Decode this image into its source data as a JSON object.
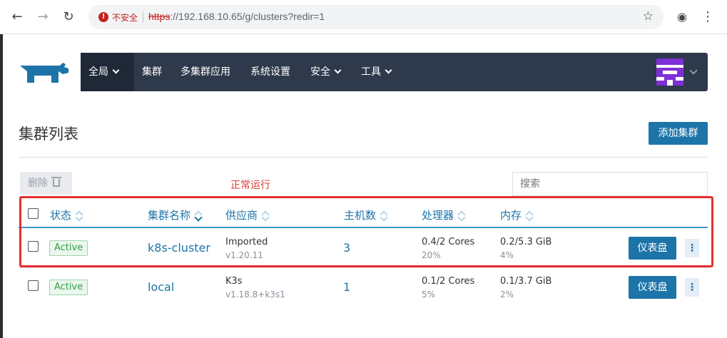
{
  "browser": {
    "insecure_label": "不安全",
    "url_protocol": "https",
    "url_rest": "://192.168.10.65/g/clusters?redir=1"
  },
  "nav": {
    "global": "全局",
    "items": [
      "集群",
      "多集群应用",
      "系统设置",
      "安全",
      "工具"
    ]
  },
  "page": {
    "title": "集群列表",
    "add_button": "添加集群",
    "delete_button": "删除",
    "annotation": "正常运行",
    "search_placeholder": "搜索"
  },
  "table": {
    "columns": [
      "状态",
      "集群名称",
      "供应商",
      "主机数",
      "处理器",
      "内存"
    ],
    "rows": [
      {
        "state": "Active",
        "name": "k8s-cluster",
        "provider": "Imported",
        "version": "v1.20.11",
        "nodes": "3",
        "cpu": "0.4/2 Cores",
        "cpu_pct": "20%",
        "mem": "0.2/5.3 GiB",
        "mem_pct": "4%",
        "dashboard": "仪表盘"
      },
      {
        "state": "Active",
        "name": "local",
        "provider": "K3s",
        "version": "v1.18.8+k3s1",
        "nodes": "1",
        "cpu": "0.1/2 Cores",
        "cpu_pct": "5%",
        "mem": "0.1/3.7 GiB",
        "mem_pct": "2%",
        "dashboard": "仪表盘"
      }
    ]
  },
  "colors": {
    "navbar": "#2e3a4b",
    "accent": "#1d74a8",
    "highlight": "#e52f2f",
    "active_badge": "#2f9e44"
  }
}
